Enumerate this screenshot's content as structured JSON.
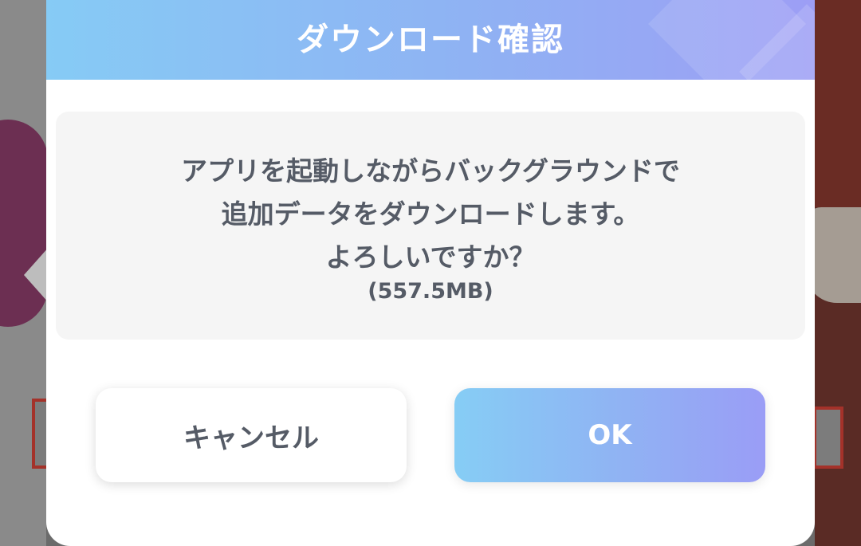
{
  "dialog": {
    "title": "ダウンロード確認",
    "message_lines": [
      "アプリを起動しながらバックグラウンドで",
      "追加データをダウンロードします。",
      "よろしいですか？"
    ],
    "download_size": "(557.5MB)",
    "buttons": {
      "cancel_label": "キャンセル",
      "ok_label": "OK"
    }
  },
  "colors": {
    "header_gradient_start": "#86cbf5",
    "header_gradient_end": "#9d9ef5",
    "text_primary": "#555b66",
    "message_background": "#f5f5f5"
  }
}
